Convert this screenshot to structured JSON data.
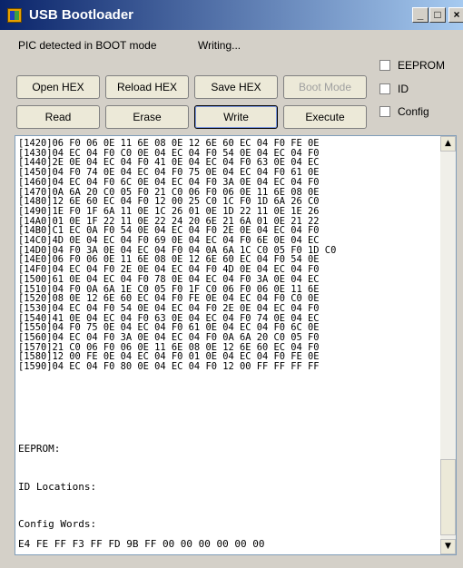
{
  "window": {
    "title": "USB Bootloader",
    "controls": {
      "minimize": "_",
      "maximize": "□",
      "close": "×"
    }
  },
  "status": {
    "detected": "PIC detected in BOOT mode",
    "state": "Writing..."
  },
  "buttons": {
    "open_hex": "Open HEX",
    "reload_hex": "Reload HEX",
    "save_hex": "Save HEX",
    "boot_mode": "Boot Mode",
    "read": "Read",
    "erase": "Erase",
    "write": "Write",
    "execute": "Execute"
  },
  "checkboxes": {
    "eeprom": "EEPROM",
    "id": "ID",
    "config": "Config"
  },
  "hex_lines": [
    "[1420]06 F0 06 0E 11 6E 08 0E 12 6E 60 EC 04 F0 FE 0E",
    "[1430]04 EC 04 F0 C0 0E 04 EC 04 F0 54 0E 04 EC 04 F0",
    "[1440]2E 0E 04 EC 04 F0 41 0E 04 EC 04 F0 63 0E 04 EC",
    "[1450]04 F0 74 0E 04 EC 04 F0 75 0E 04 EC 04 F0 61 0E",
    "[1460]04 EC 04 F0 6C 0E 04 EC 04 F0 3A 0E 04 EC 04 F0",
    "[1470]0A 6A 20 C0 05 F0 21 C0 06 F0 06 0E 11 6E 08 0E",
    "[1480]12 6E 60 EC 04 F0 12 00 25 C0 1C F0 1D 6A 26 C0",
    "[1490]1E F0 1F 6A 11 0E 1C 26 01 0E 1D 22 11 0E 1E 26",
    "[14A0]01 0E 1F 22 11 0E 22 24 20 6E 21 6A 01 0E 21 22",
    "[14B0]C1 EC 0A F0 54 0E 04 EC 04 F0 2E 0E 04 EC 04 F0",
    "[14C0]4D 0E 04 EC 04 F0 69 0E 04 EC 04 F0 6E 0E 04 EC",
    "[14D0]04 F0 3A 0E 04 EC 04 F0 04 0A 6A 1C C0 05 F0 1D C0",
    "[14E0]06 F0 06 0E 11 6E 08 0E 12 6E 60 EC 04 F0 54 0E",
    "[14F0]04 EC 04 F0 2E 0E 04 EC 04 F0 4D 0E 04 EC 04 F0",
    "[1500]61 0E 04 EC 04 F0 78 0E 04 EC 04 F0 3A 0E 04 EC",
    "[1510]04 F0 0A 6A 1E C0 05 F0 1F C0 06 F0 06 0E 11 6E",
    "[1520]08 0E 12 6E 60 EC 04 F0 FE 0E 04 EC 04 F0 C0 0E",
    "[1530]04 EC 04 F0 54 0E 04 EC 04 F0 2E 0E 04 EC 04 F0",
    "[1540]41 0E 04 EC 04 F0 63 0E 04 EC 04 F0 74 0E 04 EC",
    "[1550]04 F0 75 0E 04 EC 04 F0 61 0E 04 EC 04 F0 6C 0E",
    "[1560]04 EC 04 F0 3A 0E 04 EC 04 F0 0A 6A 20 C0 05 F0",
    "[1570]21 C0 06 F0 06 0E 11 6E 08 0E 12 6E 60 EC 04 F0",
    "[1580]12 00 FE 0E 04 EC 04 F0 01 0E 04 EC 04 F0 FE 0E",
    "[1590]04 EC 04 F0 80 0E 04 EC 04 F0 12 00 FF FF FF FF"
  ],
  "sections": {
    "eeprom": "EEPROM:",
    "id_locations": "ID Locations:",
    "config_words": "Config Words:",
    "config_values": "E4 FE FF F3 FF FD 9B FF 00 00 00 00 00 00"
  }
}
